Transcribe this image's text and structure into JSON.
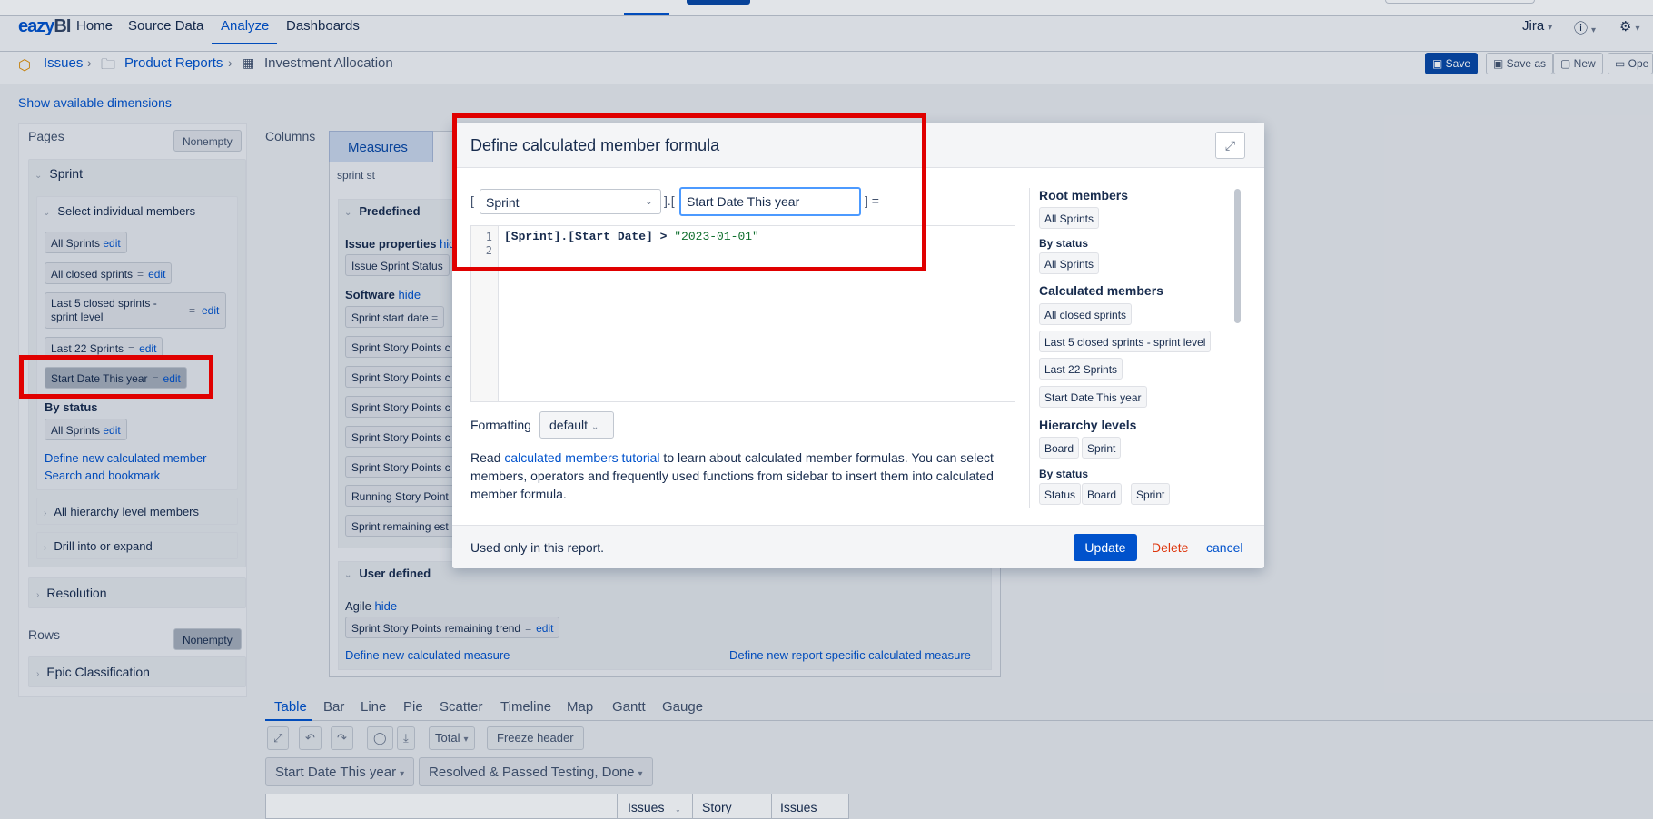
{
  "nav": {
    "logo_main": "eazy",
    "logo_bi": "BI",
    "items": [
      "Home",
      "Source Data",
      "Analyze",
      "Dashboards"
    ],
    "jira": "Jira",
    "help_icon": "question-icon",
    "settings_icon": "gear-icon"
  },
  "breadcrumb": {
    "issues": "Issues",
    "folder": "Product Reports",
    "report": "Investment Allocation",
    "sep": "›"
  },
  "toolbar": {
    "save": "Save",
    "save_as": "Save as",
    "new": "New",
    "open": "Ope"
  },
  "show_dimensions": "Show available dimensions",
  "pages": {
    "label": "Pages",
    "nonempty": "Nonempty",
    "sprint_title": "Sprint",
    "select_individual": "Select individual members",
    "members": [
      {
        "name": "All Sprints",
        "edit": "edit"
      },
      {
        "name": "All closed sprints",
        "eq": "=",
        "edit": "edit"
      },
      {
        "name": "Last 5 closed sprints - sprint level",
        "eq": "=",
        "edit": "edit"
      },
      {
        "name": "Last 22 Sprints",
        "eq": "=",
        "edit": "edit"
      },
      {
        "name": "Start Date This year",
        "eq": "=",
        "edit": "edit"
      }
    ],
    "by_status": "By status",
    "by_status_member": {
      "name": "All Sprints",
      "edit": "edit"
    },
    "define_new": "Define new calculated member",
    "search_bookmark": "Search and bookmark",
    "all_hierarchy": "All hierarchy level members",
    "drill": "Drill into or expand",
    "resolution": "Resolution"
  },
  "rows": {
    "label": "Rows",
    "nonempty": "Nonempty",
    "epic": "Epic Classification"
  },
  "columns": {
    "label": "Columns",
    "measures_tab": "Measures",
    "search_text": "sprint st",
    "predefined": "Predefined",
    "issue_props": "Issue properties",
    "issue_props_hide": "hide",
    "issue_sprint_status": "Issue Sprint Status",
    "software": "Software",
    "software_hide": "hide",
    "software_items": [
      "Sprint start date",
      "Sprint Story Points c",
      "Sprint Story Points c",
      "Sprint Story Points c",
      "Sprint Story Points c",
      "Sprint Story Points c",
      "Running Story Point",
      "Sprint remaining est"
    ],
    "user_defined": "User defined",
    "agile": "Agile",
    "agile_hide": "hide",
    "agile_item": {
      "name": "Sprint Story Points remaining trend",
      "eq": "=",
      "edit": "edit"
    },
    "define_measure": "Define new calculated measure",
    "define_report_measure": "Define new report specific calculated measure"
  },
  "bottom": {
    "tabs": [
      "Table",
      "Bar",
      "Line",
      "Pie",
      "Scatter",
      "Timeline",
      "Map",
      "Gantt",
      "Gauge"
    ],
    "total": "Total",
    "freeze": "Freeze header",
    "filter1": "Start Date This year",
    "filter2": "Resolved & Passed Testing, Done",
    "grid_headers": [
      "Issues",
      "Story",
      "Issues"
    ],
    "sort_icon": "↓"
  },
  "modal": {
    "title": "Define calculated member formula",
    "bracket_open": "[",
    "bracket_mid": "].[",
    "bracket_close": "] =",
    "dimension": "Sprint",
    "member_name": "Start Date This year",
    "line1": "1",
    "line2": "2",
    "code_part1": "[Sprint].[Start Date]",
    "code_op": " > ",
    "code_str": "\"2023-01-01\"",
    "formatting_label": "Formatting",
    "formatting_value": "default",
    "help_read": "Read ",
    "help_link": "calculated members tutorial",
    "help_rest": " to learn about calculated member formulas. You can select members, operators and frequently used functions from sidebar to insert them into calculated member formula.",
    "footer_note": "Used only in this report.",
    "update": "Update",
    "delete": "Delete",
    "cancel": "cancel",
    "sidebar": {
      "root_members": "Root members",
      "root_chip": "All Sprints",
      "by_status": "By status",
      "by_status_chip": "All Sprints",
      "calc_members": "Calculated members",
      "calc_chips": [
        "All closed sprints",
        "Last 5 closed sprints - sprint level",
        "Last 22 Sprints",
        "Start Date This year"
      ],
      "hierarchy_levels": "Hierarchy levels",
      "level_chips": [
        "Board",
        "Sprint"
      ],
      "by_status2": "By status",
      "status_chips": [
        "Status",
        "Board",
        "Sprint"
      ]
    }
  }
}
